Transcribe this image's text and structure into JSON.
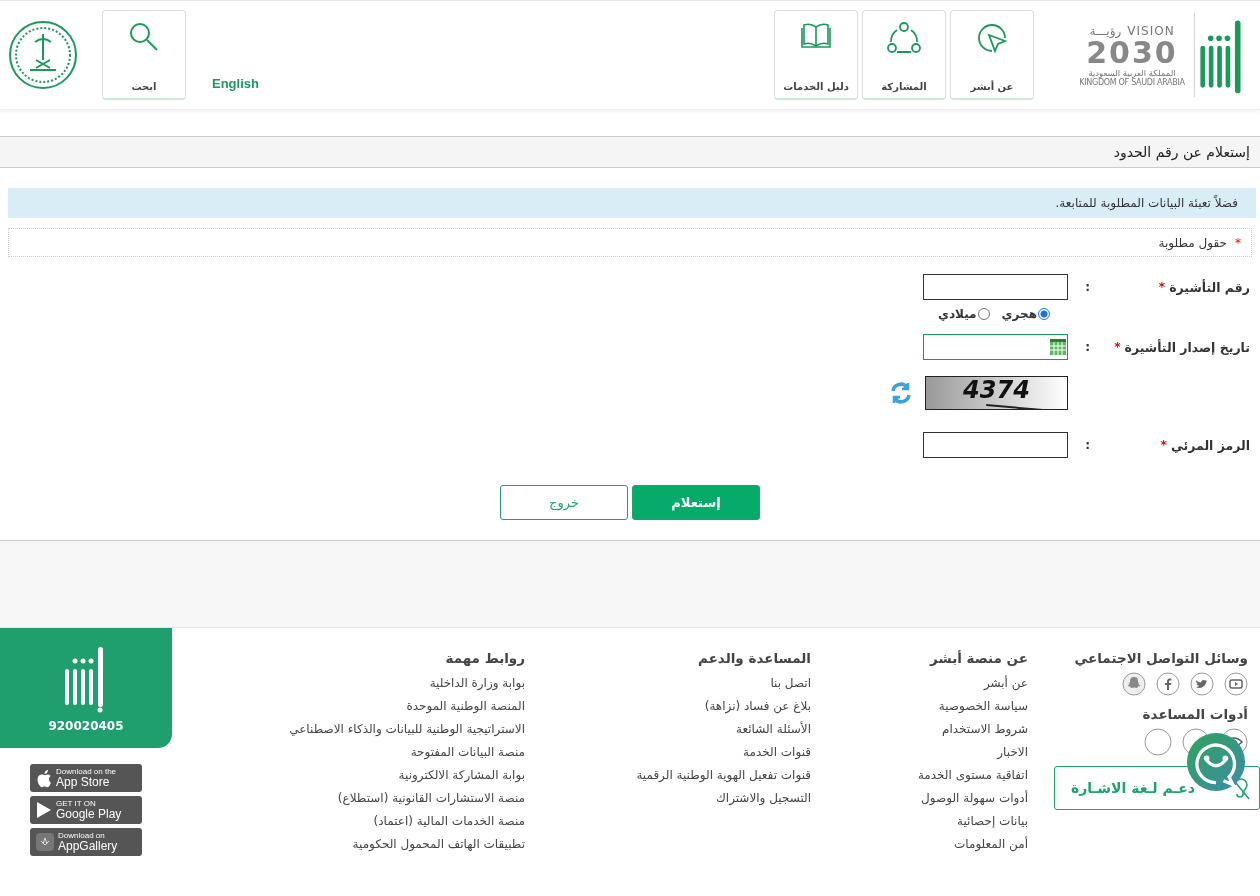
{
  "header": {
    "vision_logo": {
      "word_en": "VISION",
      "word_ar": "رؤيـــة",
      "year": "2030",
      "country_ar": "المملكة العربية السعودية",
      "country_en": "KINGDOM OF SAUDI ARABIA"
    },
    "nav": [
      {
        "kind": "cursor",
        "label": "عن أبشر"
      },
      {
        "kind": "share",
        "label": "المشاركة"
      },
      {
        "kind": "book",
        "label": "دليل الخدمات"
      }
    ],
    "language": "English",
    "search": {
      "label": "ابحث"
    }
  },
  "page_title": "إستعلام عن رقم الحدود",
  "info_message": "فضلاً تعبئة البيانات المطلوبة للمتابعة.",
  "required_note": {
    "mark": "*",
    "text": "حقول مطلوبة"
  },
  "form": {
    "rows": [
      {
        "kind": "text",
        "label": "رقم التأشيرة",
        "mark": "*",
        "colon": ":"
      },
      {
        "kind": "calendar",
        "label": "تاريخ إصدار التأشيرة",
        "mark": "*",
        "colon": ":",
        "options": [
          {
            "label": "هجري",
            "selected": true
          },
          {
            "label": "ميلادي",
            "selected": false
          }
        ]
      },
      {
        "kind": "captcha",
        "code": "4374"
      },
      {
        "kind": "text",
        "label": "الرمز المرئي",
        "mark": "*",
        "colon": ":"
      }
    ],
    "buttons": [
      {
        "kind": "primary",
        "label": "إستعلام"
      },
      {
        "kind": "secondary",
        "label": "خروج"
      }
    ]
  },
  "footer": {
    "social": {
      "title": "وسائل التواصل الاجتماعي",
      "icons": [
        {
          "kind": "youtube"
        },
        {
          "kind": "twitter"
        },
        {
          "kind": "facebook"
        },
        {
          "kind": "snapchat"
        }
      ]
    },
    "tools": {
      "title": "أدوات المساعدة"
    },
    "sign_language": "دعـم لـغة الاشـارة",
    "columns": [
      {
        "title": "عن منصة أبشر",
        "links": [
          "عن أبشر",
          "سياسة الخصوصية",
          "شروط الاستخدام",
          "الاخبار",
          "اتفاقية مستوى الخدمة",
          "أدوات سهولة الوصول",
          "بيانات إحصائية",
          "أمن المعلومات"
        ]
      },
      {
        "title": "المساعدة والدعم",
        "links": [
          "اتصل بنا",
          "بلاغ عن فساد (نزاهة)",
          "الأسئلة الشائعة",
          "قنوات الخدمة",
          "قنوات تفعيل الهوية الوطنية الرقمية",
          "التسجيل والاشتراك"
        ]
      },
      {
        "title": "روابط مهمة",
        "links": [
          "بوابة وزارة الداخلية",
          "المنصة الوطنية الموحدة",
          "الاستراتيجية الوطنية للبيانات والذكاء الاصطناعي",
          "منصة البيانات المفتوحة",
          "بوابة المشاركة الالكترونية",
          "منصة الاستشارات القانونية (استطلاع)",
          "منصة الخدمات المالية (اعتماد)",
          "تطبيقات الهاتف المحمول الحكومية"
        ]
      }
    ],
    "phone": "920020405",
    "stores": [
      {
        "kind": "apple",
        "small": "Download on the",
        "big": "App Store"
      },
      {
        "kind": "google",
        "small": "GET IT ON",
        "big": "Google Play"
      },
      {
        "kind": "huawei",
        "small": "Download on",
        "big": "AppGallery"
      }
    ]
  }
}
